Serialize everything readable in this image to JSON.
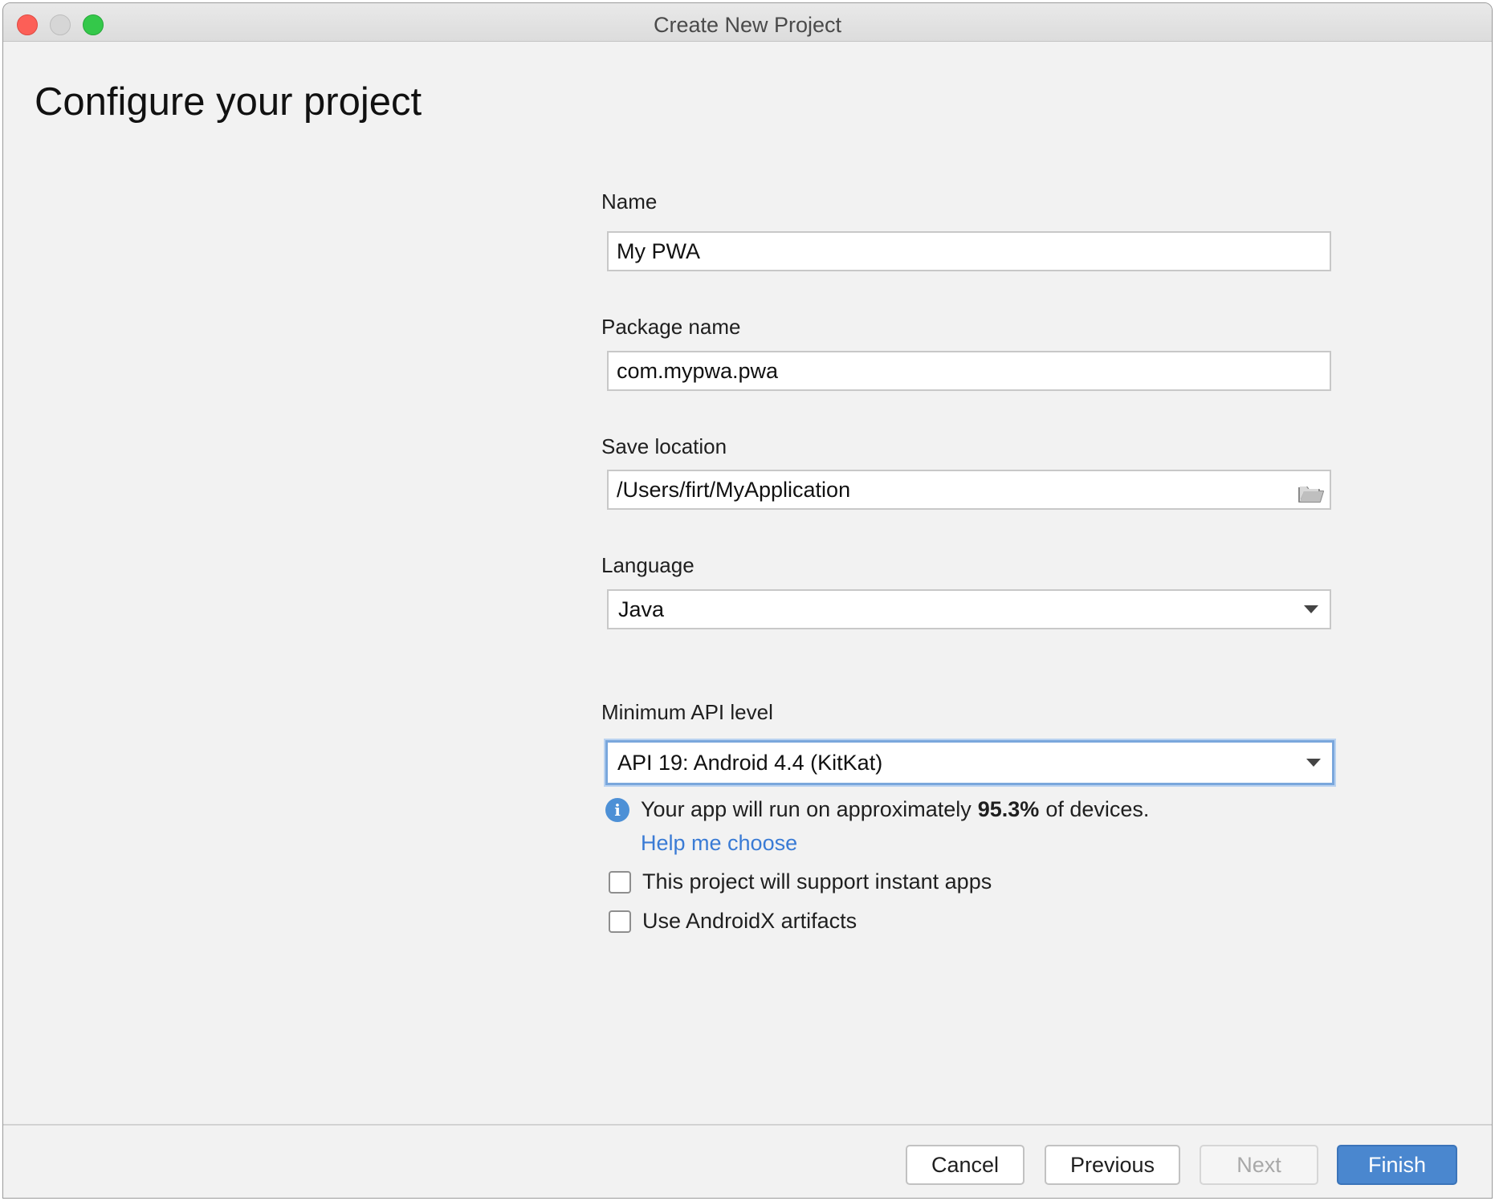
{
  "window": {
    "title": "Create New Project"
  },
  "page": {
    "title": "Configure your project"
  },
  "form": {
    "name": {
      "label": "Name",
      "value": "My PWA"
    },
    "package": {
      "label": "Package name",
      "value": "com.mypwa.pwa"
    },
    "location": {
      "label": "Save location",
      "value": "/Users/firt/MyApplication"
    },
    "language": {
      "label": "Language",
      "value": "Java"
    },
    "min_api": {
      "label": "Minimum API level",
      "value": "API 19: Android 4.4 (KitKat)"
    },
    "info": {
      "prefix": "Your app will run on approximately",
      "percent": "95.3%",
      "suffix": "of devices."
    },
    "help_link": "Help me choose",
    "instant_apps": {
      "label": "This project will support instant apps",
      "checked": false
    },
    "androidx": {
      "label": "Use AndroidX artifacts",
      "checked": false
    }
  },
  "buttons": {
    "cancel": "Cancel",
    "previous": "Previous",
    "next": "Next",
    "finish": "Finish"
  },
  "colors": {
    "accent": "#4a87cf",
    "link": "#3a7bd5",
    "focus_ring": "#7aa7dc",
    "info_icon": "#4d90d6"
  },
  "icons": {
    "info": "info-icon",
    "folder": "folder-icon",
    "dropdown": "chevron-down-icon"
  }
}
